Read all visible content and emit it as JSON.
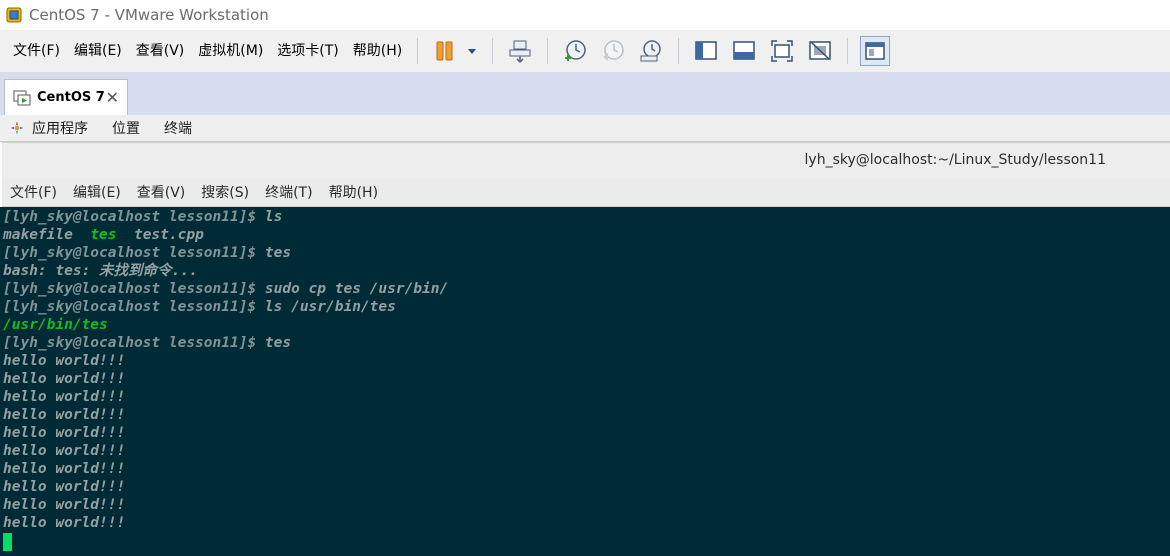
{
  "window": {
    "title": "CentOS 7 - VMware Workstation",
    "icon": "vmware-app-icon"
  },
  "vm_menu": [
    {
      "label": "文件(F)"
    },
    {
      "label": "编辑(E)"
    },
    {
      "label": "查看(V)"
    },
    {
      "label": "虚拟机(M)"
    },
    {
      "label": "选项卡(T)"
    },
    {
      "label": "帮助(H)"
    }
  ],
  "toolbar": {
    "buttons": [
      "pause-icon",
      "dropdown-arrow-icon",
      "send-ctrl-alt-del-icon",
      "snapshot-take-icon",
      "snapshot-revert-icon",
      "snapshot-manager-icon",
      "show-library-icon",
      "thumbnail-bar-icon",
      "fullscreen-icon",
      "unity-icon",
      "console-view-icon"
    ]
  },
  "tabs": [
    {
      "label": "CentOS 7",
      "close": "✕",
      "icon": "vm-tab-icon"
    }
  ],
  "gnome_panel": {
    "items": [
      {
        "label": "应用程序"
      },
      {
        "label": "位置"
      },
      {
        "label": "终端"
      }
    ]
  },
  "terminal": {
    "title": "lyh_sky@localhost:~/Linux_Study/lesson11",
    "menu": [
      {
        "label": "文件(F)"
      },
      {
        "label": "编辑(E)"
      },
      {
        "label": "查看(V)"
      },
      {
        "label": "搜索(S)"
      },
      {
        "label": "终端(T)"
      },
      {
        "label": "帮助(H)"
      }
    ],
    "lines": {
      "l01_prompt": "[lyh_sky@localhost lesson11]$ ",
      "l01_cmd": "ls",
      "l02_a": "makefile  ",
      "l02_b": "tes",
      "l02_c": "  test.cpp",
      "l03_prompt": "[lyh_sky@localhost lesson11]$ ",
      "l03_cmd": "tes",
      "l04": "bash: tes: 未找到命令...",
      "l05_prompt": "[lyh_sky@localhost lesson11]$ ",
      "l05_cmd": "sudo cp tes /usr/bin/",
      "l06_prompt": "[lyh_sky@localhost lesson11]$ ",
      "l06_cmd": "ls /usr/bin/tes",
      "l07": "/usr/bin/tes",
      "l08_prompt": "[lyh_sky@localhost lesson11]$ ",
      "l08_cmd": "tes",
      "hello": [
        "hello world!!!",
        "hello world!!!",
        "hello world!!!",
        "hello world!!!",
        "hello world!!!",
        "hello world!!!",
        "hello world!!!",
        "hello world!!!",
        "hello world!!!",
        "hello world!!!"
      ]
    },
    "colors": {
      "background": "#002b36",
      "text": "#93a1a1",
      "executable": "#0fbf21",
      "cursor": "#00e060"
    }
  }
}
